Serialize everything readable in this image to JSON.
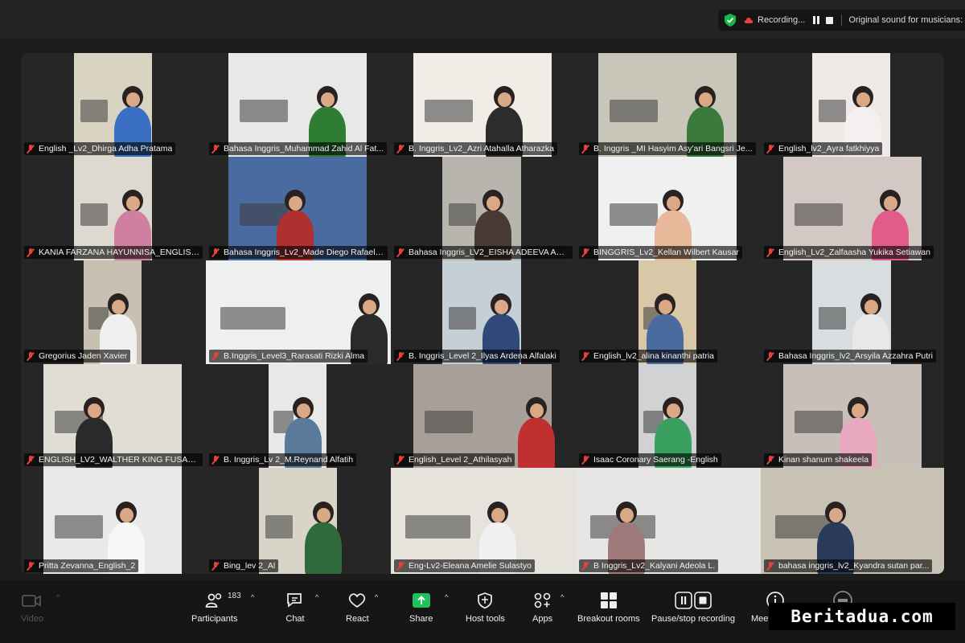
{
  "status_bar": {
    "recording_label": "Recording...",
    "original_sound_label": "Original sound for musicians: of"
  },
  "participants": [
    {
      "name": "English _Lv2_Dhirga Adha Pratama"
    },
    {
      "name": "Bahasa Inggris_Muhammad Zahid Al Fat..."
    },
    {
      "name": "B. Inggris_Lv2_Azri Atahalla Atharazka"
    },
    {
      "name": "B. Inggris _MI Hasyim Asy'ari Bangsri Je..."
    },
    {
      "name": "English_lv2_Ayra fatkhiyya"
    },
    {
      "name": "KANIA FARZANA HAYUNNISA_ENGLISH..."
    },
    {
      "name": "Bahasa Inggris_Lv2_Made Diego Rafael ..."
    },
    {
      "name": "Bahasa Inggris_LV2_EISHA ADEEVA AZZ..."
    },
    {
      "name": "BINGGRIS_Lv2_Kellan Wilbert Kausar"
    },
    {
      "name": "English_Lv2_Zalfaasha Yukika Setiawan"
    },
    {
      "name": "Gregorius Jaden Xavier"
    },
    {
      "name": "B.Inggris_Level3_Rarasati Rizki Alma"
    },
    {
      "name": "B. Inggris_Level 2_Ilyas Ardena Alfalaki"
    },
    {
      "name": "English_lv2_alina kinanthi patria"
    },
    {
      "name": "Bahasa Inggris_lv2_Arsyila Azzahra Putri"
    },
    {
      "name": "ENGLISH_LV2_WALTHER KING FUSANTO"
    },
    {
      "name": "B. Inggris_Lv 2_M.Reynand Alfatih"
    },
    {
      "name": "English_Level 2_Athilasyah"
    },
    {
      "name": "Isaac Coronary Saerang -English"
    },
    {
      "name": "Kinan shanum shakeela"
    },
    {
      "name": "Pritta Zevanna_English_2"
    },
    {
      "name": "Bing_lev 2_Al"
    },
    {
      "name": "Eng-Lv2-Eleana Amelie Sulastyo"
    },
    {
      "name": "B Inggris_Lv2_Kalyani Adeola L."
    },
    {
      "name": "bahasa inggris_lv2_Kyandra sutan par..."
    }
  ],
  "toolbar": {
    "video_label": "Video",
    "participants_label": "Participants",
    "participants_count": "183",
    "chat_label": "Chat",
    "react_label": "React",
    "share_label": "Share",
    "host_tools_label": "Host tools",
    "apps_label": "Apps",
    "breakout_label": "Breakout rooms",
    "record_label": "Pause/stop recording",
    "meeting_label": "Meeting info"
  },
  "watermark": "Beritadua.com",
  "colors": {
    "accent_green": "#17b84a",
    "mute_red": "#e5413d",
    "share_green": "#1fc25a"
  },
  "icons": {
    "shield": "shield-check-icon",
    "cloud": "cloud-record-icon",
    "video": "video-off-icon",
    "participants": "people-icon",
    "chat": "chat-icon",
    "react": "heart-icon",
    "share": "share-arrow-icon",
    "host_tools": "shield-icon",
    "apps": "apps-icon",
    "breakout": "grid-icon",
    "record": "pause-stop-icon",
    "meeting": "info-icon"
  }
}
